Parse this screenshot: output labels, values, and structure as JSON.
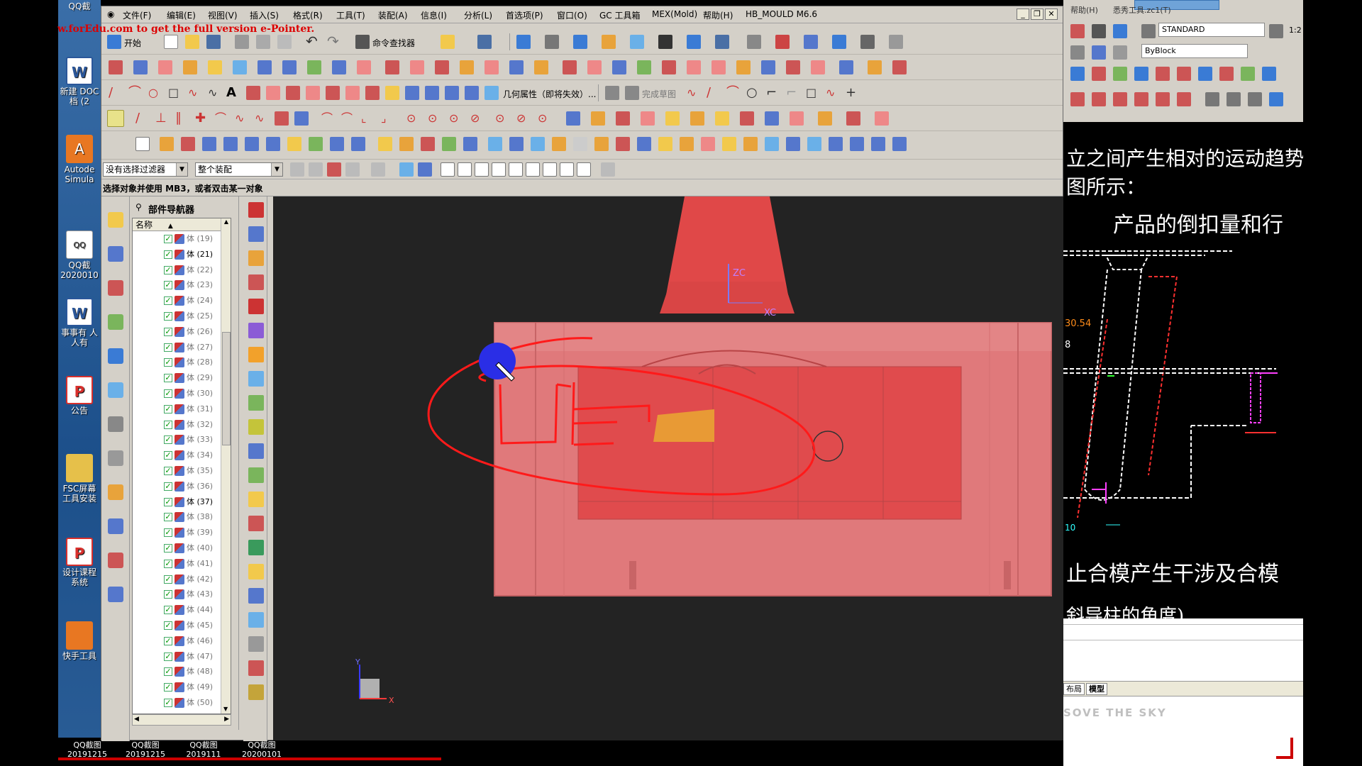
{
  "watermark": "w.forEdu.com to get the full version e-Pointer.",
  "menu": {
    "items": [
      "文件(F)",
      "编辑(E)",
      "视图(V)",
      "插入(S)",
      "格式(R)",
      "工具(T)",
      "装配(A)",
      "信息(I)",
      "分析(L)",
      "首选项(P)",
      "窗口(O)",
      "GC 工具箱",
      "MEX(Mold)",
      "帮助(H)",
      "HB_MOULD M6.6"
    ]
  },
  "toolbar": {
    "start_label": "开始",
    "command_finder_label": "命令查找器",
    "geometry_attr_label": "几何属性（即将失效）...",
    "finish_sketch_label": "完成草图"
  },
  "filter": {
    "selection_filter": "没有选择过滤器",
    "assembly_scope": "整个装配"
  },
  "status": {
    "message": "选择对象并使用 MB3，或者双击某一对象"
  },
  "navigator": {
    "title": "部件导航器",
    "column_name": "名称",
    "rows": [
      {
        "label": "体 (19)",
        "dark": false
      },
      {
        "label": "体 (21)",
        "dark": true
      },
      {
        "label": "体 (22)",
        "dark": false
      },
      {
        "label": "体 (23)",
        "dark": false
      },
      {
        "label": "体 (24)",
        "dark": false
      },
      {
        "label": "体 (25)",
        "dark": false
      },
      {
        "label": "体 (26)",
        "dark": false
      },
      {
        "label": "体 (27)",
        "dark": false
      },
      {
        "label": "体 (28)",
        "dark": false
      },
      {
        "label": "体 (29)",
        "dark": false
      },
      {
        "label": "体 (30)",
        "dark": false
      },
      {
        "label": "体 (31)",
        "dark": false
      },
      {
        "label": "体 (32)",
        "dark": false
      },
      {
        "label": "体 (33)",
        "dark": false
      },
      {
        "label": "体 (34)",
        "dark": false
      },
      {
        "label": "体 (35)",
        "dark": false
      },
      {
        "label": "体 (36)",
        "dark": false
      },
      {
        "label": "体 (37)",
        "dark": true
      },
      {
        "label": "体 (38)",
        "dark": false
      },
      {
        "label": "体 (39)",
        "dark": false
      },
      {
        "label": "体 (40)",
        "dark": false
      },
      {
        "label": "体 (41)",
        "dark": false
      },
      {
        "label": "体 (42)",
        "dark": false
      },
      {
        "label": "体 (43)",
        "dark": false
      },
      {
        "label": "体 (44)",
        "dark": false
      },
      {
        "label": "体 (45)",
        "dark": false
      },
      {
        "label": "体 (46)",
        "dark": false
      },
      {
        "label": "体 (47)",
        "dark": false
      },
      {
        "label": "体 (48)",
        "dark": false
      },
      {
        "label": "体 (49)",
        "dark": false
      },
      {
        "label": "体 (50)",
        "dark": false
      }
    ]
  },
  "viewport": {
    "axis_zc": "ZC",
    "axis_xc": "XC",
    "triad_x": "X",
    "triad_y": "Y",
    "part_color": "#e8585a",
    "background": "#232323"
  },
  "desktop": {
    "icons": [
      {
        "label": "QQ截",
        "glyph": "QQ"
      },
      {
        "label": "新建 DOC 档 (2",
        "glyph": "W"
      },
      {
        "label": "Autode Simula",
        "glyph": "A"
      },
      {
        "label": "QQ截 2020010",
        "glyph": "QQ"
      },
      {
        "label": "事事有 人人有",
        "glyph": "W"
      },
      {
        "label": "公告",
        "glyph": "P"
      },
      {
        "label": "FSC屏幕 工具安装",
        "glyph": ""
      },
      {
        "label": "设计课程 系统",
        "glyph": "P"
      },
      {
        "label": "快手工具",
        "glyph": ""
      }
    ],
    "taskbar": [
      "QQ截图 20191215",
      "QQ截图 20191215",
      "QQ截图 2019111",
      "QQ截图 20200101"
    ]
  },
  "cad": {
    "help_menu": "帮助(H)",
    "title_fragment": "悉秀工具.zc1(T)",
    "style_combo": "STANDARD",
    "layer_combo": "ByBlock",
    "scale_text": "1:2",
    "doc_lines": [
      "立之间产生相对的运动趋势",
      "图所示：",
      "产品的倒扣量和行",
      "止合模产生干涉及合模",
      "斜导柱的角度)"
    ],
    "dim_30": "30.54",
    "dim_8": "8",
    "dim_10": "10",
    "tab_layout": "布局",
    "tab_model": "模型",
    "sky_text": "SOVE THE SKY"
  }
}
